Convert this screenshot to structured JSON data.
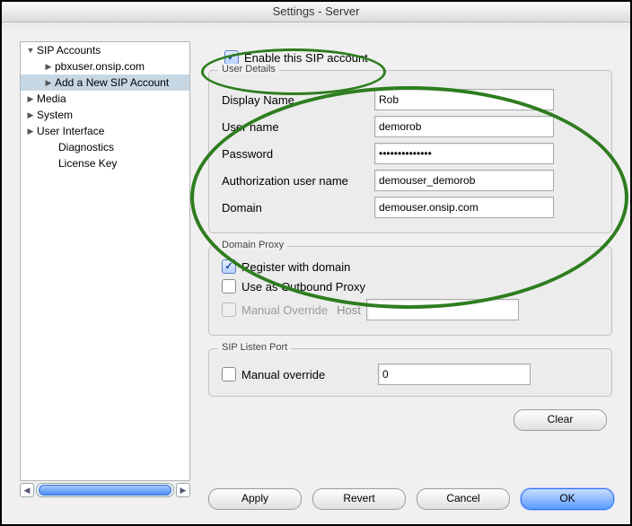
{
  "window": {
    "title": "Settings - Server"
  },
  "sidebar": {
    "items": [
      {
        "label": "SIP Accounts",
        "expanded": true,
        "children": [
          {
            "label": "pbxuser.onsip.com",
            "selected": false
          },
          {
            "label": "Add a New SIP Account",
            "selected": true
          }
        ]
      },
      {
        "label": "Media"
      },
      {
        "label": "System"
      },
      {
        "label": "User Interface"
      },
      {
        "label": "Diagnostics"
      },
      {
        "label": "License Key"
      }
    ]
  },
  "main": {
    "enable_label": "Enable this SIP account",
    "enable_checked": true,
    "user_details": {
      "legend": "User Details",
      "fields": [
        {
          "label": "Display Name",
          "value": "Rob"
        },
        {
          "label": "User name",
          "value": "demorob"
        },
        {
          "label": "Password",
          "value": "••••••••••••••"
        },
        {
          "label": "Authorization user name",
          "value": "demouser_demorob"
        },
        {
          "label": "Domain",
          "value": "demouser.onsip.com"
        }
      ]
    },
    "domain_proxy": {
      "legend": "Domain Proxy",
      "register_label": "Register with domain",
      "register_checked": true,
      "outbound_label": "Use as Outbound Proxy",
      "outbound_checked": false,
      "manual_label": "Manual Override",
      "manual_enabled": false,
      "host_label": "Host",
      "host_value": ""
    },
    "listen_port": {
      "legend": "SIP Listen Port",
      "manual_label": "Manual override",
      "manual_checked": false,
      "value": "0"
    }
  },
  "buttons": {
    "clear": "Clear",
    "apply": "Apply",
    "revert": "Revert",
    "cancel": "Cancel",
    "ok": "OK"
  },
  "annotations": {
    "color": "#2e7d1f",
    "ellipses": [
      "enable-checkbox-highlight",
      "user-details-highlight"
    ]
  }
}
